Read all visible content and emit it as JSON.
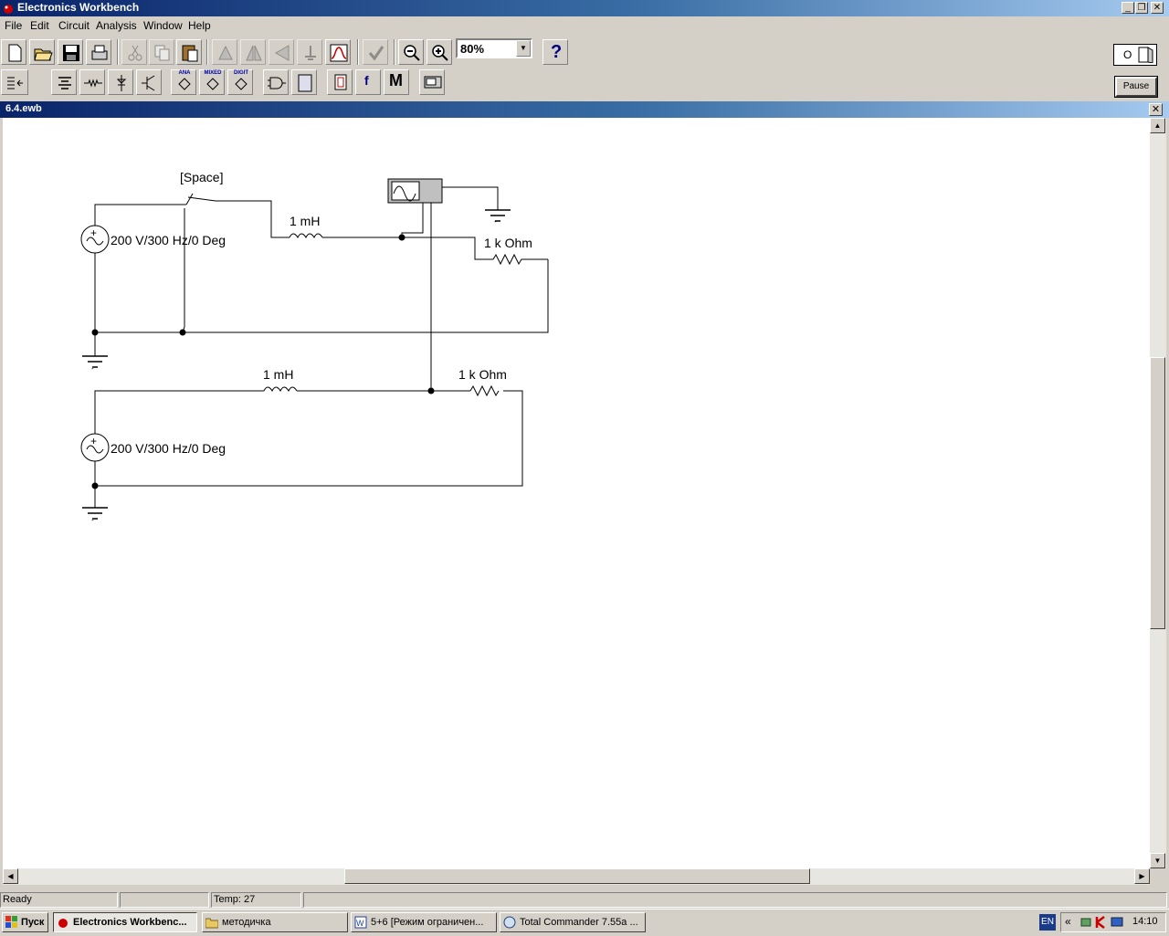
{
  "app": {
    "title": "Electronics Workbench"
  },
  "menu": [
    "File",
    "Edit",
    "Circuit",
    "Analysis",
    "Window",
    "Help"
  ],
  "toolbar": {
    "zoom": "80%",
    "help_label": "?",
    "tiny_labels": [
      "ANA",
      "MIXED",
      "DIGIT"
    ],
    "meter_label": "M",
    "func_label": "f"
  },
  "power": {
    "pause_label": "Pause",
    "switch_label": "O"
  },
  "document": {
    "title": "6.4.ewb"
  },
  "circuit": {
    "switch_key": "[Space]",
    "top_inductor": "1 mH",
    "top_resistor": "1 k Ohm",
    "top_source": "200 V/300 Hz/0 Deg",
    "bottom_inductor": "1 mH",
    "bottom_resistor": "1 k Ohm",
    "bottom_source": "200 V/300 Hz/0 Deg"
  },
  "status": {
    "ready": "Ready",
    "temp": "Temp:  27"
  },
  "taskbar": {
    "start": "Пуск",
    "tasks": [
      "Electronics Workbenc...",
      "методичка",
      "5+6 [Режим ограничен...",
      "Total Commander 7.55a ..."
    ],
    "lang": "EN",
    "clock": "14:10"
  },
  "colors": {
    "titlebar": "#0a246a",
    "face": "#d4d0c8",
    "canvas": "#ffffff"
  }
}
